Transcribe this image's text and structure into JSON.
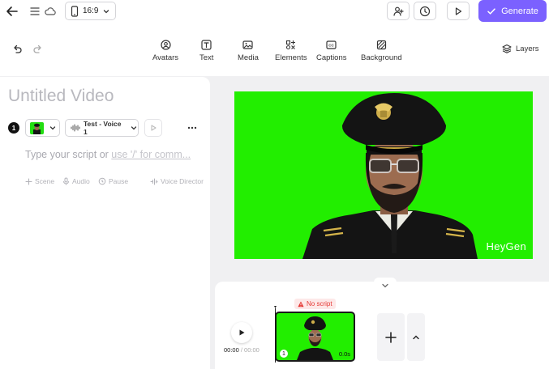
{
  "topbar": {
    "aspect_ratio": "16:9",
    "generate_label": "Generate",
    "accent_color": "#7b61ff"
  },
  "toolbar": {
    "tools": [
      {
        "label": "Avatars",
        "icon": "avatar-icon"
      },
      {
        "label": "Text",
        "icon": "text-icon"
      },
      {
        "label": "Media",
        "icon": "image-icon"
      },
      {
        "label": "Elements",
        "icon": "elements-icon"
      },
      {
        "label": "Captions",
        "icon": "captions-icon"
      },
      {
        "label": "Background",
        "icon": "background-icon"
      }
    ],
    "layers_label": "Layers"
  },
  "script": {
    "title": "Untitled Video",
    "scene_number": "1",
    "voice_label": "Test - Voice 1",
    "placeholder_main": "Type your script or ",
    "placeholder_hint": "use '/' for comm...",
    "actions": {
      "scene": "Scene",
      "audio": "Audio",
      "pause": "Pause",
      "voice_director": "Voice Director"
    }
  },
  "preview": {
    "background_color": "#22ee00",
    "watermark": "HeyGen"
  },
  "timeline": {
    "current_time": "00:00",
    "separator": " / ",
    "total_time": "00:00",
    "warning": "No script",
    "clip_number": "1",
    "clip_duration": "0.0s"
  }
}
